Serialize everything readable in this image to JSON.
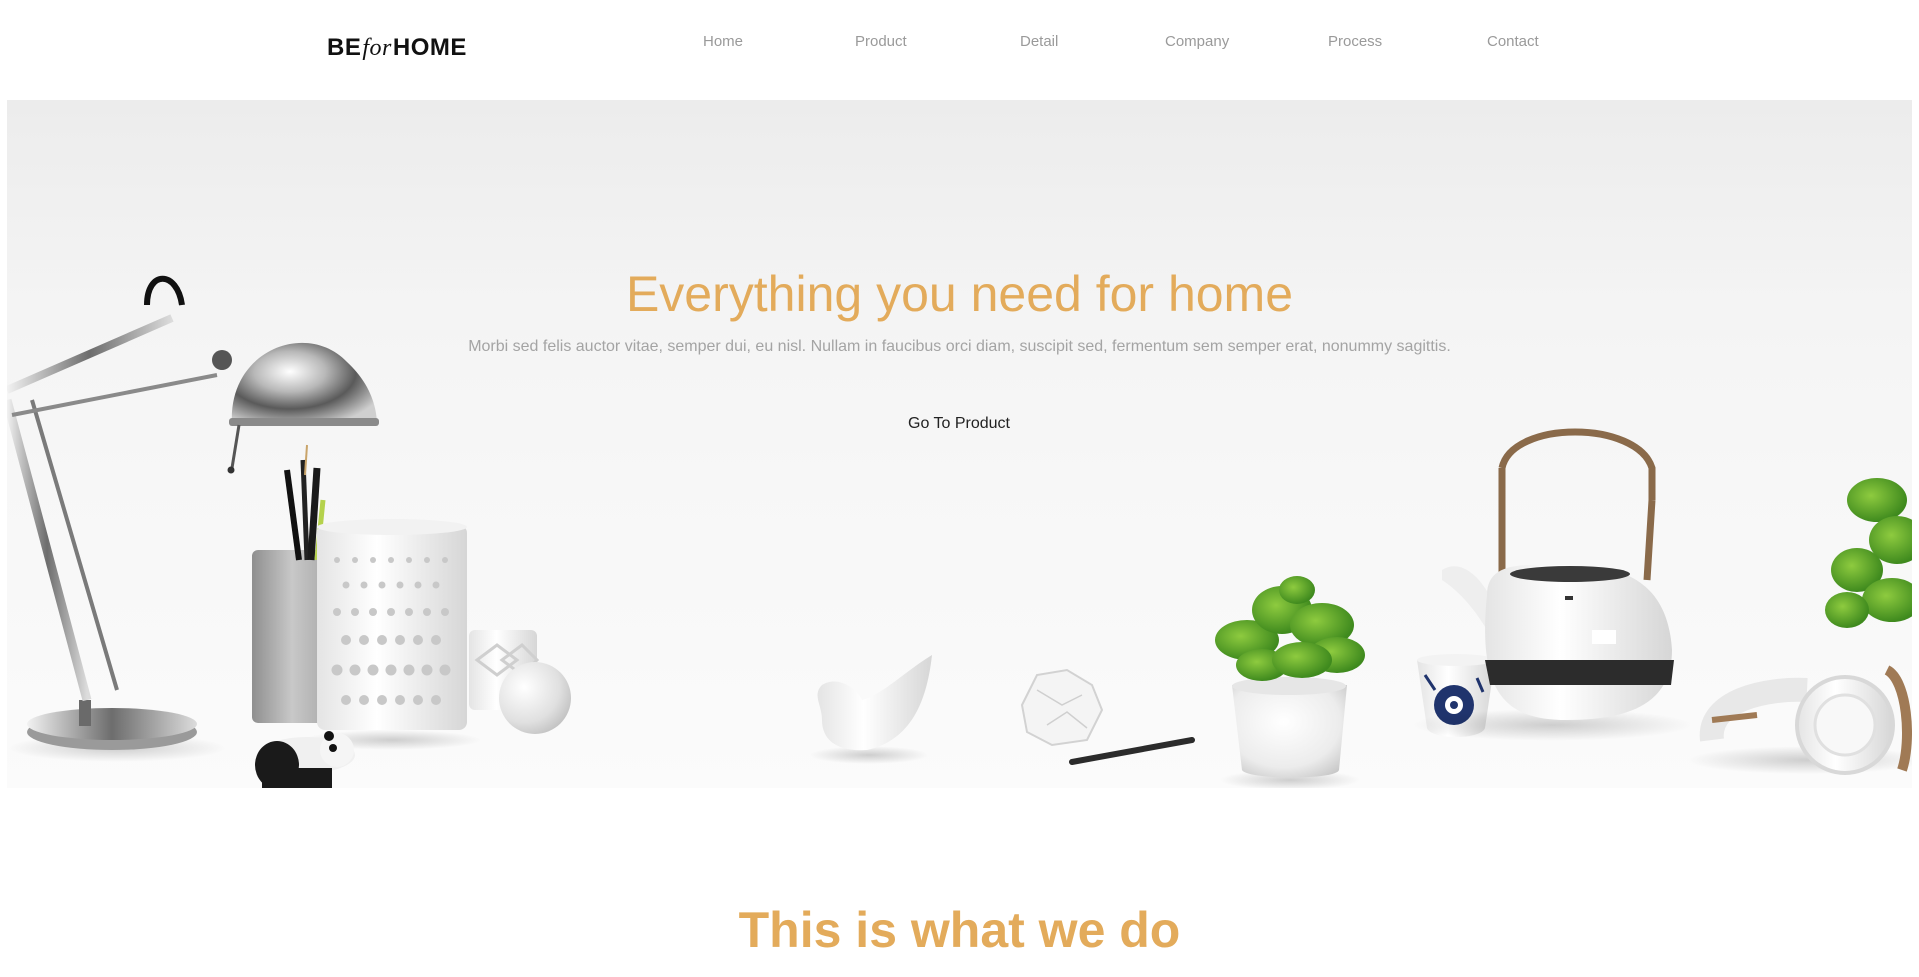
{
  "brand": {
    "logo_left": "BE",
    "logo_mid": "for",
    "logo_right": "HOME"
  },
  "nav": {
    "items": [
      {
        "label": "Home"
      },
      {
        "label": "Product"
      },
      {
        "label": "Detail"
      },
      {
        "label": "Company"
      },
      {
        "label": "Process"
      },
      {
        "label": "Contact"
      }
    ]
  },
  "hero": {
    "title": "Everything you need for home",
    "subtitle": "Morbi sed felis auctor vitae, semper dui, eu nisl. Nullam in faucibus orci diam, suscipit sed, fermentum sem semper erat, nonummy sagittis.",
    "cta_label": "Go To Product"
  },
  "section": {
    "title": "This is what we do"
  },
  "colors": {
    "accent": "#e3ab5b",
    "nav_text": "#9a9a9a",
    "body_text": "#a4a4a4"
  }
}
